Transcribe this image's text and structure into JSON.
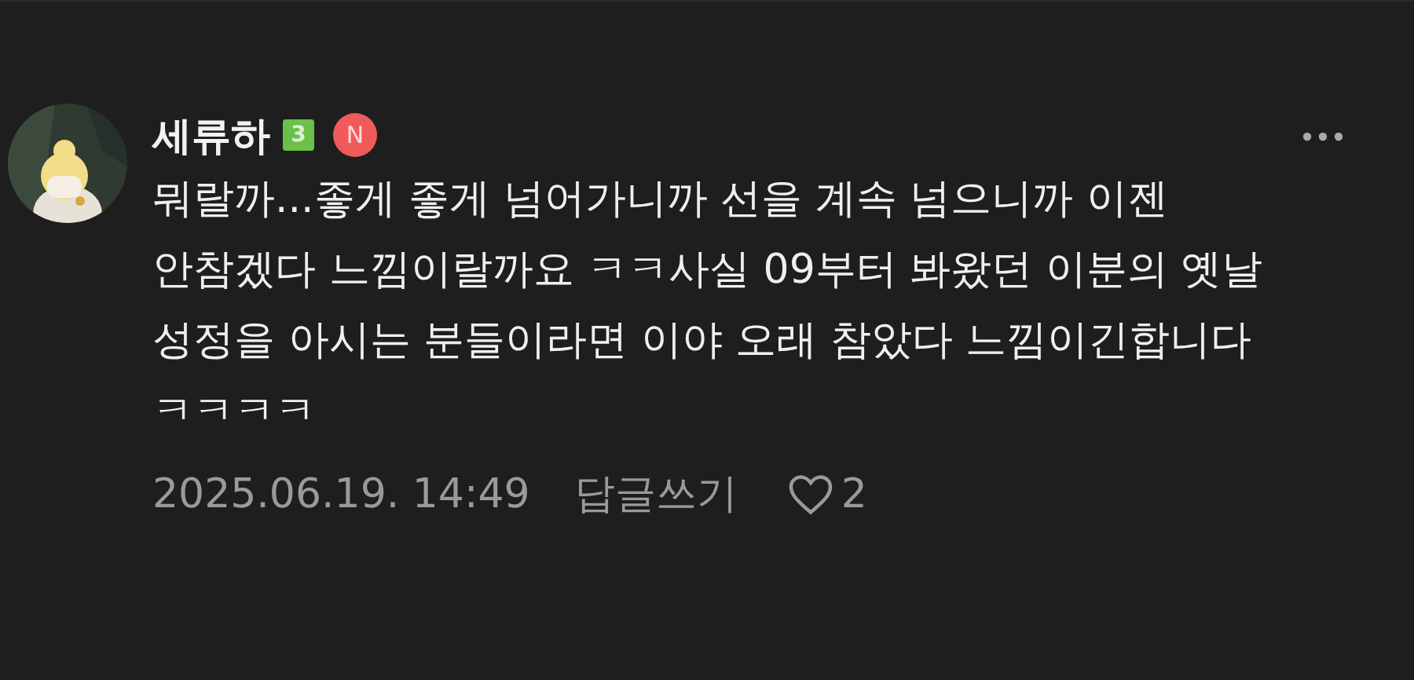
{
  "comment": {
    "author": "세류하",
    "level_badge": "3",
    "new_badge": "N",
    "text": "뭐랄까...좋게 좋게 넘어가니까 선을 계속 넘으니까 이젠 안참겠다 느낌이랄까요 ㅋㅋ사실 09부터 봐왔던 이분의 옛날 성정을 아시는 분들이라면 이야 오래 참았다 느낌이긴합니다 ㅋㅋㅋㅋ",
    "date": "2025.06.19. 14:49",
    "reply": "답글쓰기",
    "likes": "2"
  }
}
